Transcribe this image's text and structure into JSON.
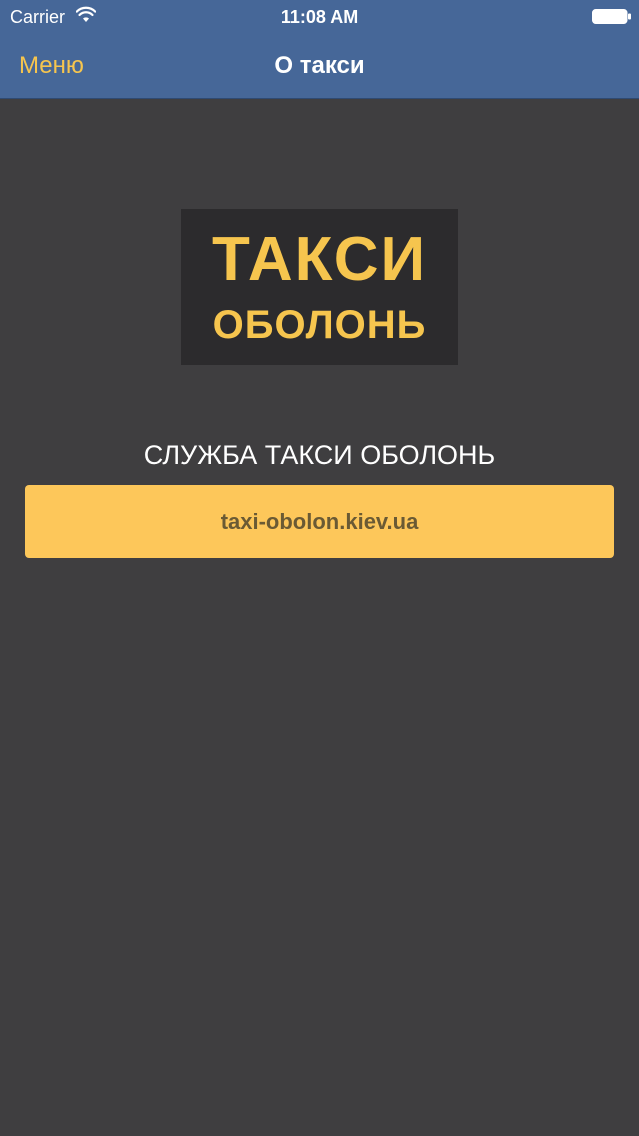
{
  "status_bar": {
    "carrier": "Carrier",
    "time": "11:08 AM",
    "wifi_icon": "wifi-icon",
    "battery_icon": "battery-icon"
  },
  "nav": {
    "back_label": "Меню",
    "title": "О такси"
  },
  "logo": {
    "line1": "ТАКСИ",
    "line2": "ОБОЛОНЬ"
  },
  "main": {
    "service_title": "СЛУЖБА ТАКСИ ОБОЛОНЬ",
    "website_label": "taxi-obolon.kiev.ua"
  },
  "colors": {
    "navbar": "#466798",
    "background": "#3f3e40",
    "accent": "#f6c54e",
    "button": "#fdc75a",
    "button_text": "#6a5a34",
    "logo_bg": "#2c2b2d"
  }
}
